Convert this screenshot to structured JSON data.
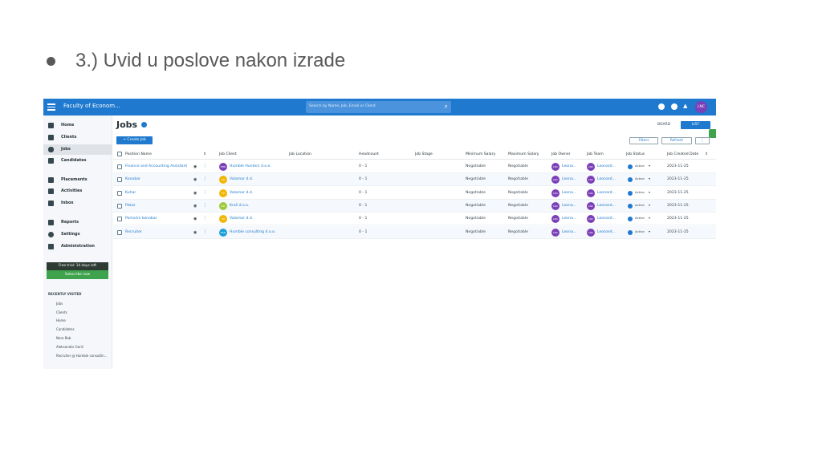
{
  "slide": {
    "bullet_text": "3.) Uvid u poslove nakon izrade"
  },
  "topbar": {
    "app_title": "Faculty of Econom...",
    "search_placeholder": "Search by Name, Job, Email or Client",
    "user_initials": "LNC"
  },
  "sidebar": {
    "items": [
      {
        "label": "Home",
        "icon": "home-icon"
      },
      {
        "label": "Clients",
        "icon": "bank-icon"
      },
      {
        "label": "Jobs",
        "icon": "briefcase-icon",
        "active": true
      },
      {
        "label": "Candidates",
        "icon": "people-icon"
      },
      {
        "label": "Placements",
        "icon": "person-add-icon"
      },
      {
        "label": "Activities",
        "icon": "calendar-icon"
      },
      {
        "label": "Inbox",
        "icon": "chat-icon"
      },
      {
        "label": "Reports",
        "icon": "report-icon"
      },
      {
        "label": "Settings",
        "icon": "gear-icon"
      },
      {
        "label": "Administration",
        "icon": "lock-icon"
      }
    ],
    "trial_text": "Free trial: 14 days left",
    "subscribe_label": "Subscribe now",
    "recent_title": "RECENTLY VISITED",
    "recent_items": [
      "Jobs",
      "Clients",
      "Home",
      "Candidates",
      "Nero Bob",
      "Aleksandar Gorić",
      "Recruiter @ Humble consultin..."
    ]
  },
  "main": {
    "title": "Jobs",
    "board_label": "BOARD",
    "list_label": "LIST",
    "create_label": "+ Create Job",
    "filters_label": "Filters",
    "refresh_label": "Refresh",
    "more_label": "⋮",
    "columns": [
      "Position Name",
      "Job Client",
      "Job Location",
      "Headcount",
      "Job Stage",
      "Minimum Salary",
      "Maximum Salary",
      "Job Owner",
      "Job Team",
      "Job Status",
      "Job Created Date"
    ],
    "rows": [
      {
        "position": "Finance and Accounting Assistant",
        "client": "Humble Hunters d.o.o.",
        "client_initials": "HHD",
        "client_color": "#7b3fb8",
        "location": "",
        "headcount": "0 - 1",
        "stage": "",
        "min_salary": "Negotiable",
        "max_salary": "Negotiable",
        "owner": "Leona...",
        "team": "Leonard...",
        "status": "Active",
        "created": "2023-11-25"
      },
      {
        "position": "Konobar",
        "client": "Valamar d.d.",
        "client_initials": "VD",
        "client_color": "#f2b705",
        "location": "",
        "headcount": "0 - 1",
        "stage": "",
        "min_salary": "Negotiable",
        "max_salary": "Negotiable",
        "owner": "Leona...",
        "team": "Leonard...",
        "status": "Active",
        "created": "2023-11-25"
      },
      {
        "position": "Kuhar",
        "client": "Valamar d.d.",
        "client_initials": "VD",
        "client_color": "#f2b705",
        "location": "",
        "headcount": "0 - 1",
        "stage": "",
        "min_salary": "Negotiable",
        "max_salary": "Negotiable",
        "owner": "Leona...",
        "team": "Leonard...",
        "status": "Active",
        "created": "2023-11-25"
      },
      {
        "position": "Pekar",
        "client": "Kraš d.o.o.",
        "client_initials": "KD",
        "client_color": "#9ccc3c",
        "location": "",
        "headcount": "0 - 1",
        "stage": "",
        "min_salary": "Negotiable",
        "max_salary": "Negotiable",
        "owner": "Leona...",
        "team": "Leonard...",
        "status": "Active",
        "created": "2023-11-25"
      },
      {
        "position": "Pomoćni konobar",
        "client": "Valamar d.d.",
        "client_initials": "VD",
        "client_color": "#f2b705",
        "location": "",
        "headcount": "0 - 1",
        "stage": "",
        "min_salary": "Negotiable",
        "max_salary": "Negotiable",
        "owner": "Leona...",
        "team": "Leonard...",
        "status": "Active",
        "created": "2023-11-25"
      },
      {
        "position": "Recruiter",
        "client": "Humble consulting d.o.o.",
        "client_initials": "HCD",
        "client_color": "#1e9fd8",
        "location": "",
        "headcount": "0 - 1",
        "stage": "",
        "min_salary": "Negotiable",
        "max_salary": "Negotiable",
        "owner": "Leona...",
        "team": "Leonard...",
        "status": "Active",
        "created": "2023-11-25"
      }
    ],
    "owner_initials": "LNC"
  }
}
